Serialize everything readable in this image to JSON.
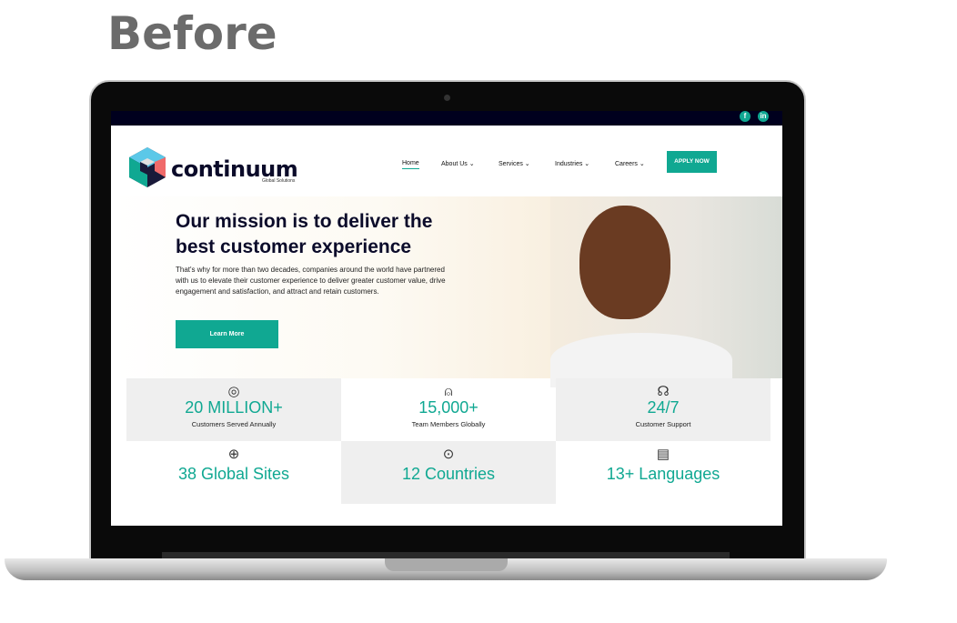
{
  "caption": "Before",
  "site": {
    "brand": "continuum",
    "tagline": "Global Solutions",
    "social": [
      {
        "icon": "facebook-icon",
        "label": "f"
      },
      {
        "icon": "linkedin-icon",
        "label": "in"
      }
    ],
    "nav": [
      {
        "label": "Home",
        "active": true
      },
      {
        "label": "About Us ⌄"
      },
      {
        "label": "Services ⌄"
      },
      {
        "label": "Industries ⌄"
      },
      {
        "label": "Careers ⌄"
      }
    ],
    "apply_label": "APPLY NOW",
    "hero": {
      "title": "Our mission is to deliver the best customer experience",
      "text": "That's why for more than two decades, companies around the world have partnered with us to elevate their customer experience to deliver greater customer value, drive engagement and satisfaction, and attract and retain customers.",
      "button": "Learn More"
    },
    "stats": [
      {
        "icon": "target-icon",
        "glyph": "◎",
        "value": "20 MILLION+",
        "label": "Customers Served Annually"
      },
      {
        "icon": "user-icon",
        "glyph": "⍝",
        "value": "15,000+",
        "label": "Team Members Globally"
      },
      {
        "icon": "headset-icon",
        "glyph": "☊",
        "value": "24/7",
        "label": "Customer Support"
      },
      {
        "icon": "globe-icon",
        "glyph": "⊕",
        "value": "38 Global Sites"
      },
      {
        "icon": "location-pin-icon",
        "glyph": "⊙",
        "value": "12 Countries"
      },
      {
        "icon": "chat-icon",
        "glyph": "▤",
        "value": "13+ Languages"
      }
    ],
    "accent": "#10a892",
    "dark": "#0b0b2a"
  }
}
